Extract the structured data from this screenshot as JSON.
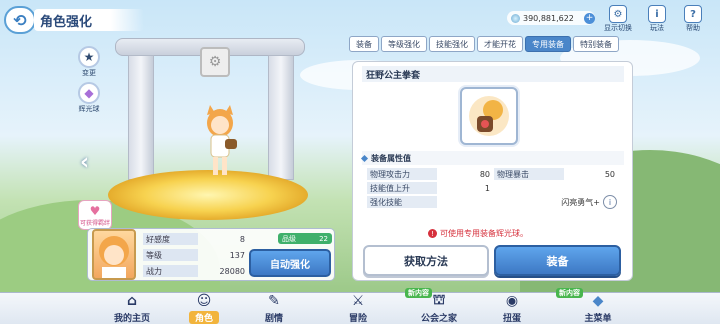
{
  "header": {
    "title": "角色强化",
    "currency": "390,881,622",
    "top_icons": [
      {
        "label": "显示切换",
        "icon": "gear-icon"
      },
      {
        "label": "玩法",
        "icon": "info-icon"
      },
      {
        "label": "帮助",
        "icon": "help-icon"
      }
    ]
  },
  "side_items": [
    {
      "label": "变更",
      "icon": "star-icon"
    },
    {
      "label": "辉光球",
      "icon": "gem-icon"
    }
  ],
  "tabs": [
    {
      "label": "装备",
      "active": false
    },
    {
      "label": "等级强化",
      "active": false
    },
    {
      "label": "技能强化",
      "active": false
    },
    {
      "label": "才能开花",
      "active": false
    },
    {
      "label": "专用装备",
      "active": true
    },
    {
      "label": "特别装备",
      "active": false
    }
  ],
  "equipment": {
    "name": "狂野公主拳套",
    "section_title": "装备属性值",
    "stats": [
      {
        "name": "物理攻击力",
        "value": "80"
      },
      {
        "name": "物理暴击",
        "value": "50"
      },
      {
        "name": "技能值上升",
        "value": "1"
      },
      {
        "name": "强化技能",
        "value": "闪亮勇气+"
      }
    ],
    "warning": "可使用专用装备辉光球。",
    "btn_get": "获取方法",
    "btn_equip": "装备"
  },
  "character": {
    "fav_badge": "可获得羁绊",
    "rank_label": "品级",
    "rank_value": "22",
    "stats": [
      {
        "name": "好感度",
        "value": "8"
      },
      {
        "name": "等级",
        "value": "137"
      },
      {
        "name": "战力",
        "value": "28080"
      }
    ],
    "auto_btn": "自动强化"
  },
  "bottom_nav": [
    {
      "label": "我的主页",
      "icon": "home-icon",
      "active": false
    },
    {
      "label": "角色",
      "icon": "character-icon",
      "active": true
    },
    {
      "label": "剧情",
      "icon": "story-icon",
      "active": false
    },
    {
      "label": "冒险",
      "icon": "sword-icon",
      "active": false
    },
    {
      "label": "公会之家",
      "icon": "guild-icon",
      "active": false
    },
    {
      "label": "扭蛋",
      "icon": "gacha-icon",
      "active": false
    },
    {
      "label": "主菜单",
      "icon": "crystal-icon",
      "active": false
    }
  ],
  "new_tags": [
    "新内容",
    "新内容"
  ]
}
